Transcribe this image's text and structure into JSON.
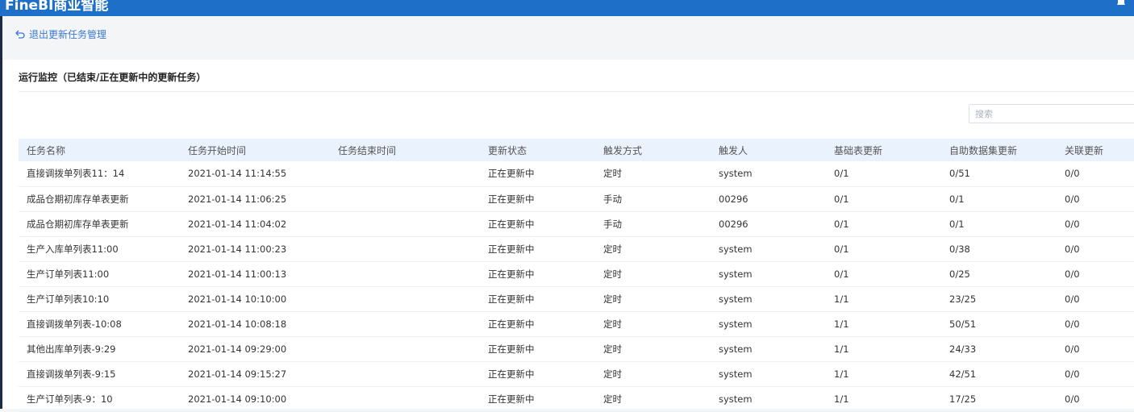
{
  "app": {
    "title": "FineBI商业智能"
  },
  "nav": {
    "back_label": "退出更新任务管理"
  },
  "section": {
    "title": "运行监控（已结束/正在更新中的更新任务）"
  },
  "search": {
    "placeholder": "搜索"
  },
  "table": {
    "columns": [
      "任务名称",
      "任务开始时间",
      "任务结束时间",
      "更新状态",
      "触发方式",
      "触发人",
      "基础表更新",
      "自助数据集更新",
      "关联更新"
    ],
    "rows": [
      [
        "直接调拨单列表11：14",
        "2021-01-14 11:14:55",
        "",
        "正在更新中",
        "定时",
        "system",
        "0/1",
        "0/51",
        "0/0"
      ],
      [
        "成品仓期初库存单表更新",
        "2021-01-14 11:06:25",
        "",
        "正在更新中",
        "手动",
        "00296",
        "0/1",
        "0/1",
        "0/0"
      ],
      [
        "成品仓期初库存单表更新",
        "2021-01-14 11:04:02",
        "",
        "正在更新中",
        "手动",
        "00296",
        "0/1",
        "0/1",
        "0/0"
      ],
      [
        "生产入库单列表11:00",
        "2021-01-14 11:00:23",
        "",
        "正在更新中",
        "定时",
        "system",
        "0/1",
        "0/38",
        "0/0"
      ],
      [
        "生产订单列表11:00",
        "2021-01-14 11:00:13",
        "",
        "正在更新中",
        "定时",
        "system",
        "0/1",
        "0/25",
        "0/0"
      ],
      [
        "生产订单列表10:10",
        "2021-01-14 10:10:00",
        "",
        "正在更新中",
        "定时",
        "system",
        "1/1",
        "23/25",
        "0/0"
      ],
      [
        "直接调拨单列表-10:08",
        "2021-01-14 10:08:18",
        "",
        "正在更新中",
        "定时",
        "system",
        "1/1",
        "50/51",
        "0/0"
      ],
      [
        "其他出库单列表-9:29",
        "2021-01-14 09:29:00",
        "",
        "正在更新中",
        "定时",
        "system",
        "1/1",
        "24/33",
        "0/0"
      ],
      [
        "直接调拨单列表-9:15",
        "2021-01-14 09:15:27",
        "",
        "正在更新中",
        "定时",
        "system",
        "1/1",
        "42/51",
        "0/0"
      ],
      [
        "生产订单列表-9：10",
        "2021-01-14 09:10:00",
        "",
        "正在更新中",
        "定时",
        "system",
        "1/1",
        "17/25",
        "0/0"
      ]
    ]
  },
  "colors": {
    "header_bar": "#1e6fc8",
    "link": "#3a78d4",
    "table_header_bg": "#eaf2fd"
  }
}
